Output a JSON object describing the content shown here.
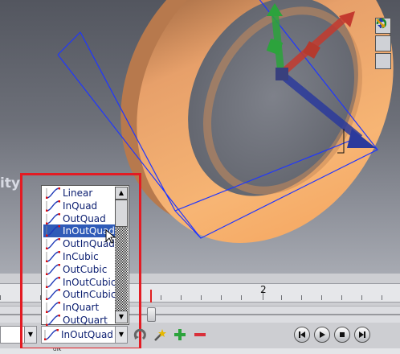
{
  "viewport": {
    "background_text": "ity",
    "colors": {
      "ring": "#f4a35a",
      "bbox": "#1f36ff",
      "gizmo_red": "#c43a2e",
      "gizmo_green": "#2ca33c",
      "gizmo_blue": "#2b3a9c"
    }
  },
  "gizmo_tools": [
    {
      "name": "rotate-tool-icon"
    },
    {
      "name": "move-tool-icon"
    },
    {
      "name": "scale-tool-icon"
    }
  ],
  "timeline": {
    "ruler_label": "2",
    "status_text": "dik"
  },
  "easing": {
    "selected": "InOutQuad",
    "options": [
      "Linear",
      "InQuad",
      "OutQuad",
      "InOutQuad",
      "OutInQuad",
      "InCubic",
      "OutCubic",
      "InOutCubic",
      "OutInCubic",
      "InQuart",
      "OutQuart"
    ],
    "highlighted_index": 3
  },
  "toolbar": [
    {
      "name": "rotate-key-icon"
    },
    {
      "name": "magic-wand-icon"
    },
    {
      "name": "add-key-icon"
    },
    {
      "name": "remove-key-icon"
    }
  ],
  "media_controls": [
    {
      "name": "previous-key-icon"
    },
    {
      "name": "play-icon"
    },
    {
      "name": "stop-icon"
    },
    {
      "name": "next-key-icon"
    }
  ],
  "highlight_color": "#e31b23"
}
